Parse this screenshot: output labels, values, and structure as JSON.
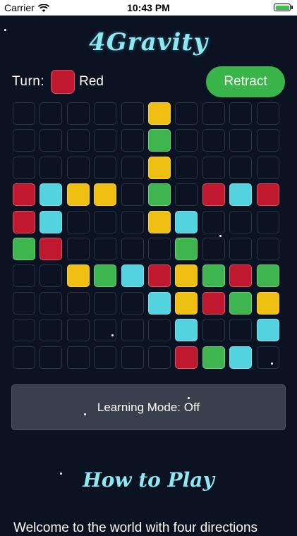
{
  "status_bar": {
    "carrier": "Carrier",
    "time": "10:43 PM"
  },
  "title": "4Gravity",
  "turn": {
    "label": "Turn:",
    "player": "Red",
    "color": "#c0182e"
  },
  "retract_label": "Retract",
  "colors": {
    "R": "#c0182e",
    "C": "#53d2df",
    "Y": "#efbf12",
    "G": "#3fb550",
    "retract": "#3ab54a"
  },
  "board": [
    ".....Y....",
    ".....G....",
    ".....Y....",
    "RCYY.G.RCR",
    "RC...YC...",
    "GR....G...",
    "..YGCRYGRG",
    ".....CYRGY",
    "......C..C",
    "......RGC."
  ],
  "learning_mode": "Learning Mode: Off",
  "how_to_play": "How to Play",
  "welcome_text": "Welcome to the world with four directions"
}
